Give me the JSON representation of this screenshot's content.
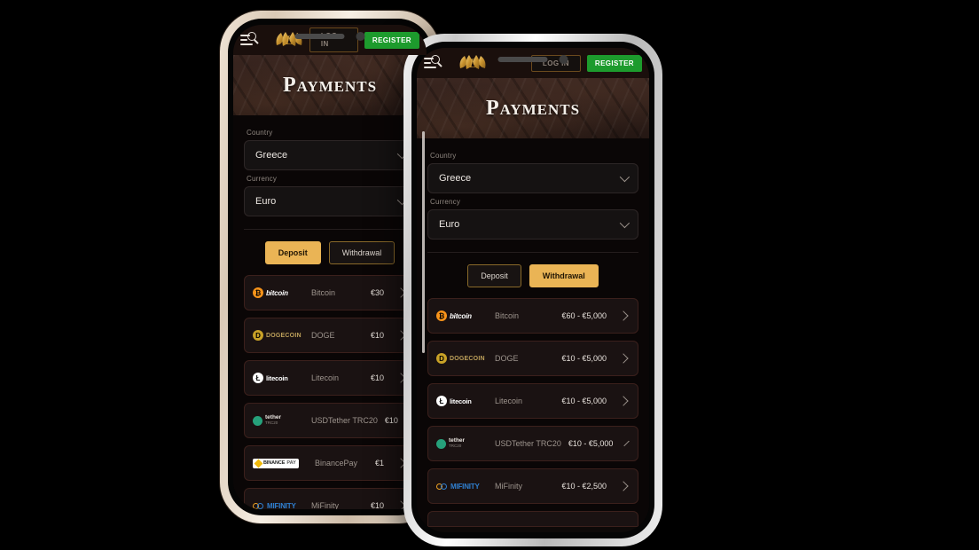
{
  "header": {
    "menu_icon": "menu-search-icon",
    "logo": "laurel-wreath-logo",
    "login_label": "LOG IN",
    "register_label": "REGISTER"
  },
  "page": {
    "title": "Payments"
  },
  "form": {
    "country_label": "Country",
    "country_value": "Greece",
    "currency_label": "Currency",
    "currency_value": "Euro",
    "chevron_icon": "chevron-down-icon"
  },
  "tabs": {
    "deposit_label": "Deposit",
    "withdrawal_label": "Withdrawal"
  },
  "colors": {
    "accent_gold": "#eab455",
    "register_green": "#1d9b2d",
    "banner_brown": "#2e1e19",
    "page_bg": "#0a0606",
    "row_bg": "#1a1212",
    "row_border": "#3b201c"
  },
  "front_phone": {
    "active_tab": "Withdrawal",
    "rows": [
      {
        "logo": "bitcoin-logo",
        "mark": "bitcoin",
        "name": "Bitcoin",
        "range": "€60 - €5,000"
      },
      {
        "logo": "dogecoin-logo",
        "mark": "dogecoin",
        "name": "DOGE",
        "range": "€10 - €5,000"
      },
      {
        "logo": "litecoin-logo",
        "mark": "litecoin",
        "name": "Litecoin",
        "range": "€10 - €5,000"
      },
      {
        "logo": "tether-logo",
        "mark": "tether",
        "name": "USDTether TRC20",
        "range": "€10 - €5,000"
      },
      {
        "logo": "mifinity-logo",
        "mark": "mifinity",
        "name": "MiFinity",
        "range": "€10 - €2,500"
      }
    ]
  },
  "back_phone": {
    "active_tab": "Deposit",
    "rows": [
      {
        "logo": "bitcoin-logo",
        "mark": "bitcoin",
        "name": "Bitcoin",
        "range": "€30"
      },
      {
        "logo": "dogecoin-logo",
        "mark": "dogecoin",
        "name": "DOGE",
        "range": "€10"
      },
      {
        "logo": "litecoin-logo",
        "mark": "litecoin",
        "name": "Litecoin",
        "range": "€10"
      },
      {
        "logo": "tether-logo",
        "mark": "tether",
        "name": "USDTether TRC20",
        "range": "€10"
      },
      {
        "logo": "binancepay-logo",
        "mark": "binancepay",
        "name": "BinancePay",
        "range": "€1"
      },
      {
        "logo": "mifinity-logo",
        "mark": "mifinity",
        "name": "MiFinity",
        "range": "€10"
      }
    ]
  }
}
